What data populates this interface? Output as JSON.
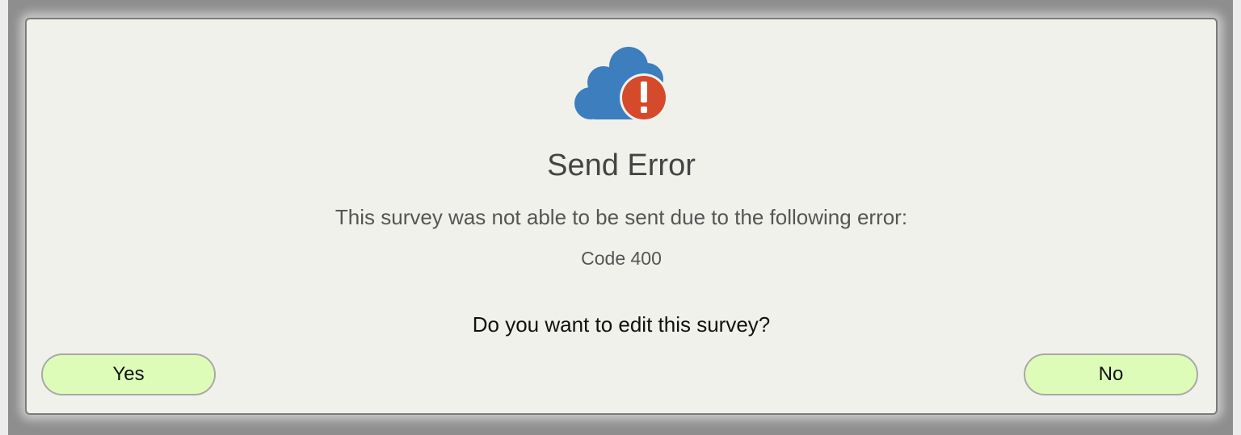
{
  "dialog": {
    "title": "Send Error",
    "message": "This survey was not able to be sent due to the following error:",
    "error_code": "Code 400",
    "question": "Do you want to edit this survey?",
    "icon": "cloud-error-icon",
    "buttons": {
      "yes_label": "Yes",
      "no_label": "No"
    }
  },
  "colors": {
    "cloud": "#3d7ebf",
    "alert": "#d54a2b",
    "button_fill": "#ddfcb8",
    "dialog_bg": "#f1f1ec"
  }
}
